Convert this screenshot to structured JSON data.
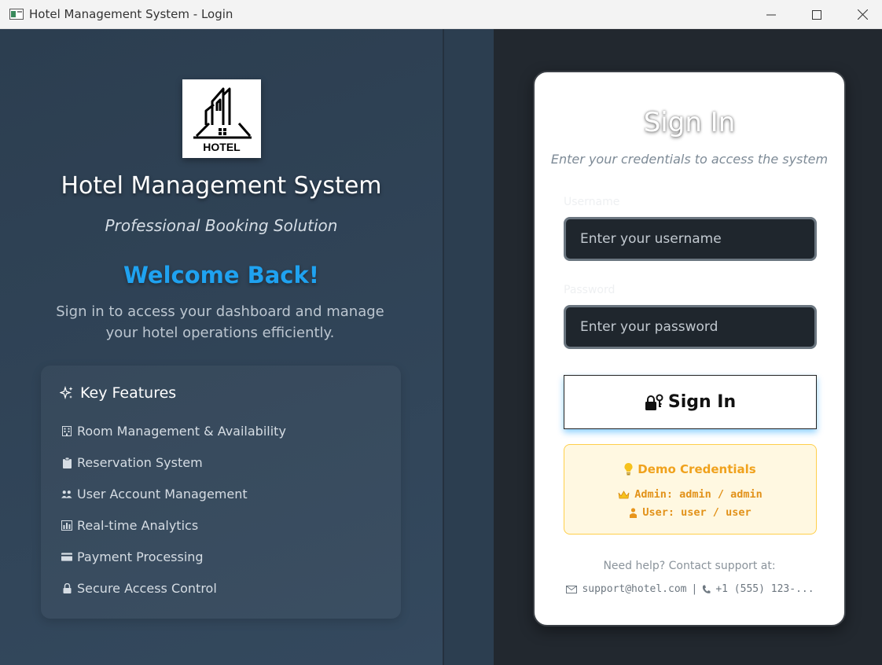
{
  "window": {
    "title": "Hotel Management System - Login"
  },
  "branding": {
    "logo_text": "HOTEL",
    "app_title": "Hotel Management System",
    "subtitle": "Professional Booking Solution",
    "welcome": "Welcome Back!",
    "welcome_desc": "Sign in to access your dashboard and manage your hotel operations efficiently."
  },
  "features": {
    "title": "Key Features",
    "items": [
      {
        "label": "Room Management & Availability",
        "icon": "building-icon"
      },
      {
        "label": "Reservation System",
        "icon": "clipboard-icon"
      },
      {
        "label": "User Account Management",
        "icon": "users-icon"
      },
      {
        "label": "Real-time Analytics",
        "icon": "chart-icon"
      },
      {
        "label": "Payment Processing",
        "icon": "credit-card-icon"
      },
      {
        "label": "Secure Access Control",
        "icon": "lock-icon"
      }
    ]
  },
  "login": {
    "title": "Sign In",
    "subtitle": "Enter your credentials to access the system",
    "username_label": "Username",
    "username_placeholder": "Enter your username",
    "password_label": "Password",
    "password_placeholder": "Enter your password",
    "signin_button": "Sign In"
  },
  "demo": {
    "title": "Demo Credentials",
    "admin": "Admin: admin / admin",
    "user": "User: user / user"
  },
  "support": {
    "help_text": "Need help? Contact support at:",
    "email": "support@hotel.com",
    "separator": "|",
    "phone": "+1 (555) 123-..."
  },
  "colors": {
    "accent": "#1fa2f0",
    "panel_dark": "#2c3e50",
    "demo_text": "#f0a21d"
  }
}
